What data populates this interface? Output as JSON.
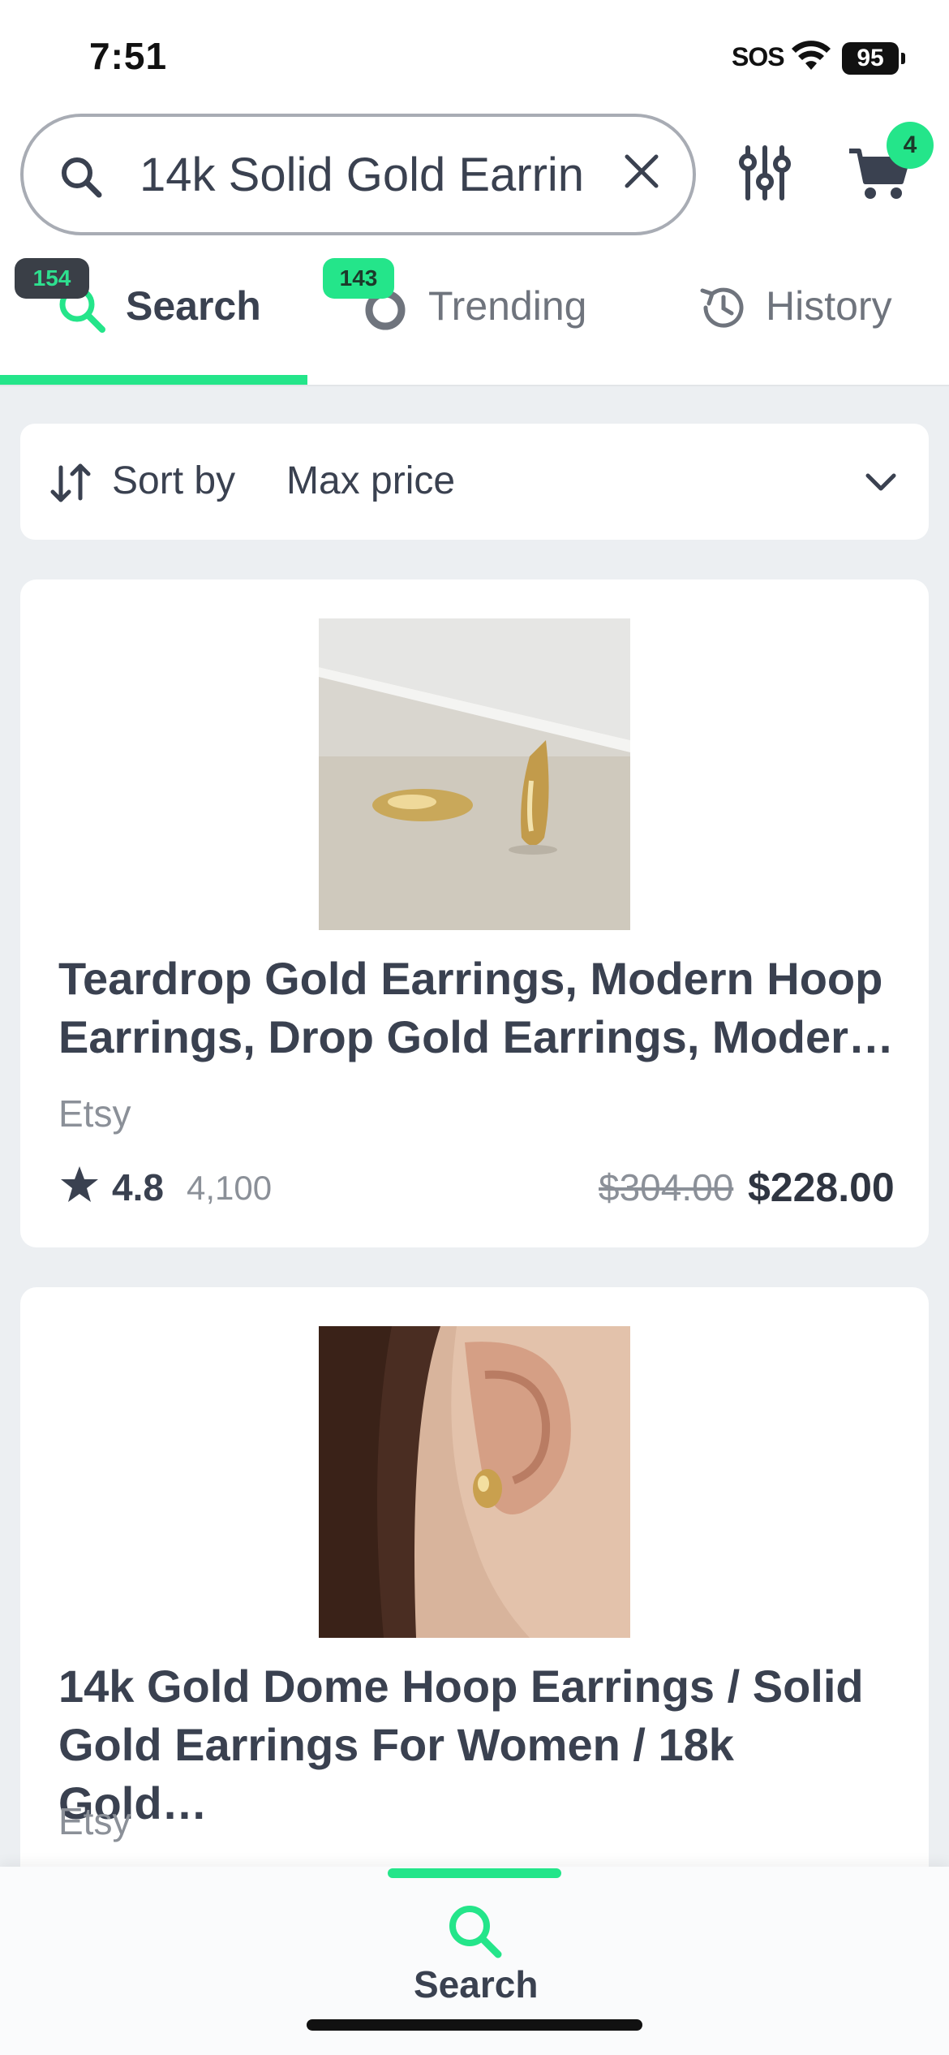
{
  "status_bar": {
    "time": "7:51",
    "carrier": "SOS",
    "battery": "95"
  },
  "header": {
    "search_value": "14k Solid Gold Earrin",
    "cart_count": "4"
  },
  "tabs": [
    {
      "label": "Search",
      "badge": "154",
      "active": true
    },
    {
      "label": "Trending",
      "badge": "143",
      "active": false
    },
    {
      "label": "History",
      "badge": "",
      "active": false
    }
  ],
  "sort": {
    "label": "Sort by",
    "value": "Max price"
  },
  "products": [
    {
      "title": "Teardrop Gold Earrings, Modern Hoop Earrings, Drop Gold Earrings, Moder…",
      "store": "Etsy",
      "rating": "4.8",
      "reviews": "4,100",
      "old_price": "$304.00",
      "price": "$228.00"
    },
    {
      "title": "14k Gold Dome Hoop Earrings / Solid Gold Earrings For Women / 18k Gold…",
      "store": "Etsy"
    }
  ],
  "bottom_nav": {
    "active_label": "Search"
  },
  "colors": {
    "accent": "#24e58a",
    "text": "#3a4150",
    "muted": "#8b9098",
    "background": "#eceff2"
  }
}
